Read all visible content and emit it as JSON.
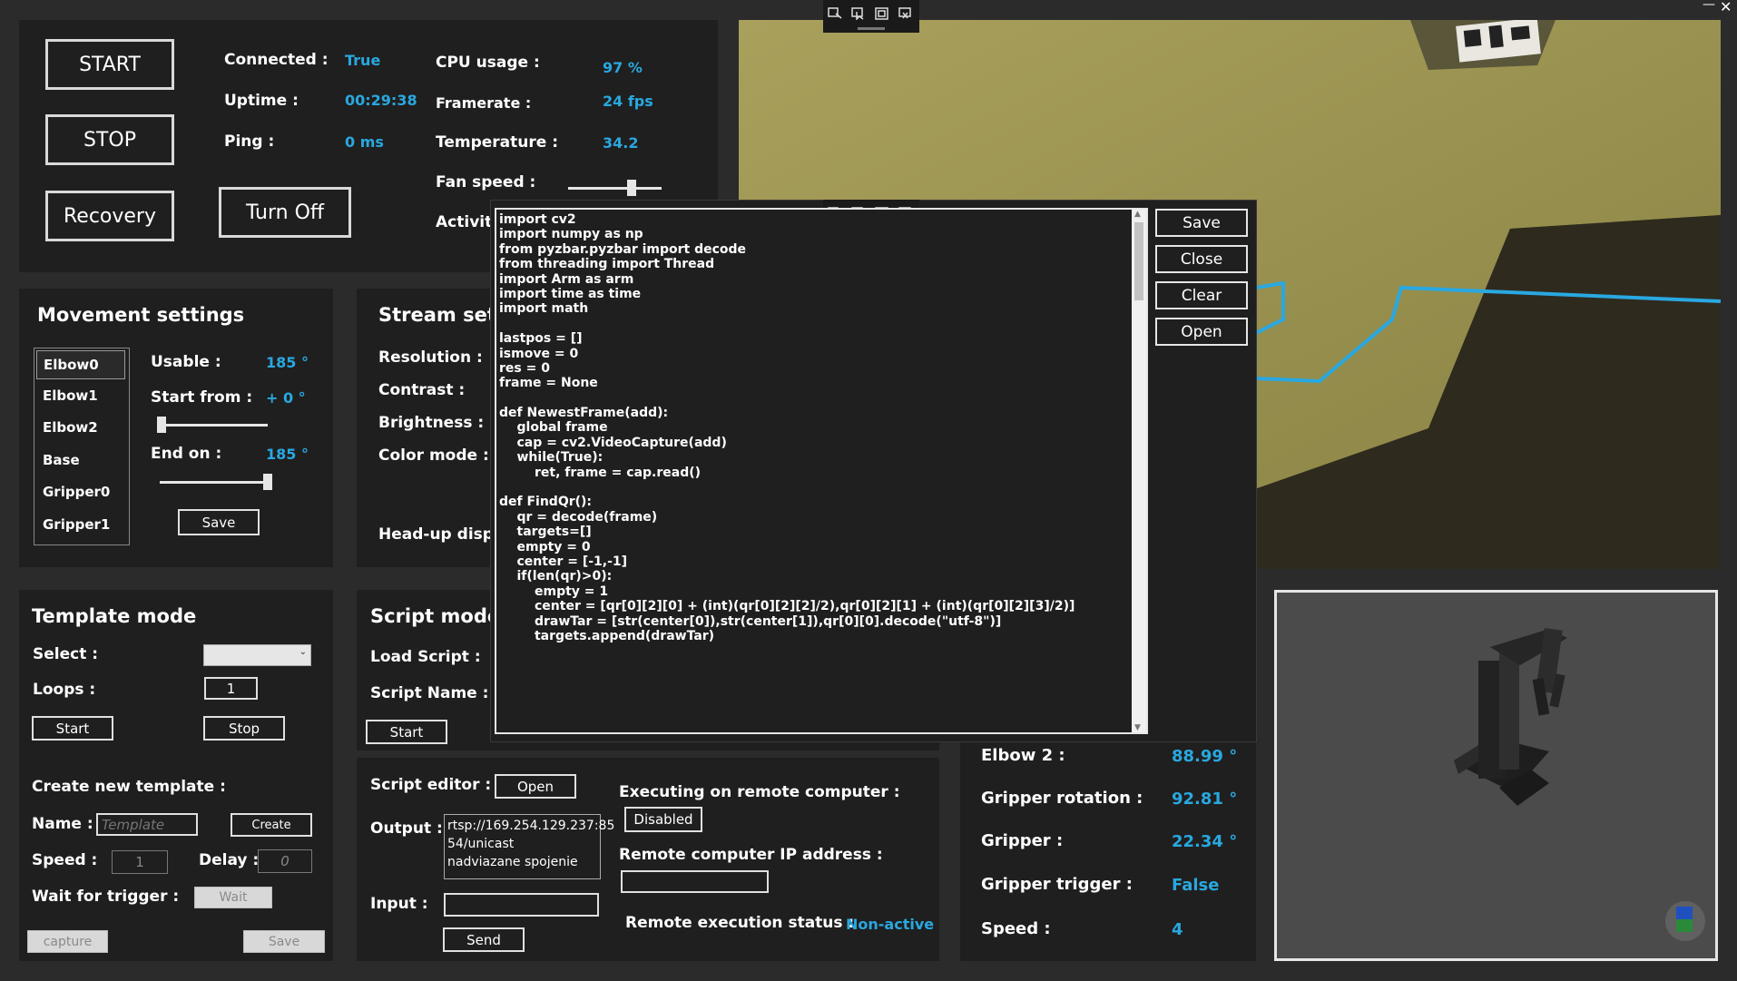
{
  "window": {
    "minimize_glyph": "—",
    "close_glyph": "✕"
  },
  "controls": {
    "start": "START",
    "stop": "STOP",
    "recovery": "Recovery",
    "turn_off": "Turn Off"
  },
  "status": {
    "connected_label": "Connected :",
    "connected_value": "True",
    "uptime_label": "Uptime :",
    "uptime_value": "00:29:38",
    "ping_label": "Ping :",
    "ping_value": "0 ms",
    "cpu_label": "CPU usage :",
    "cpu_value": "97 %",
    "framerate_label": "Framerate :",
    "framerate_value": "24 fps",
    "temperature_label": "Temperature :",
    "temperature_value": "34.2",
    "fan_label": "Fan speed :",
    "fan_level": 0.7,
    "activity_label": "Activit"
  },
  "movement": {
    "title": "Movement settings",
    "joints": [
      "Elbow0",
      "Elbow1",
      "Elbow2",
      "Base",
      "Gripper0",
      "Gripper1"
    ],
    "selected_joint": "Elbow0",
    "usable_label": "Usable :",
    "usable_value": "185 °",
    "start_label": "Start from :",
    "start_value": "+ 0 °",
    "start_level": 0.0,
    "end_label": "End on :",
    "end_value": "185 °",
    "end_level": 1.0,
    "save": "Save"
  },
  "stream": {
    "title": "Stream sett",
    "resolution_label": "Resolution :",
    "contrast_label": "Contrast :",
    "brightness_label": "Brightness :",
    "color_label": "Color mode :",
    "hud_label": "Head-up displ"
  },
  "template": {
    "title": "Template mode",
    "select_label": "Select :",
    "select_value": "",
    "loops_label": "Loops :",
    "loops_value": "1",
    "start": "Start",
    "stop": "Stop",
    "create_title": "Create new template :",
    "name_label": "Name :",
    "name_placeholder": "Template",
    "create": "Create",
    "speed_label": "Speed :",
    "speed_value": "1",
    "delay_label": "Delay :",
    "delay_value": "0",
    "trigger_label": "Wait for trigger :",
    "wait": "Wait",
    "capture": "capture",
    "save": "Save"
  },
  "script": {
    "title": "Script mode",
    "load_label": "Load Script :",
    "name_label": "Script Name :",
    "start": "Start",
    "editor_label": "Script editor :",
    "editor_open": "Open",
    "output_label": "Output :",
    "output_lines": [
      "rtsp://169.254.129.237:85",
      "54/unicast",
      "nadviazane spojenie"
    ],
    "input_label": "Input :",
    "input_value": "",
    "send": "Send"
  },
  "remote": {
    "exec_label": "Executing on remote computer :",
    "exec_button": "Disabled",
    "ip_label": "Remote computer IP address :",
    "ip_value": "",
    "status_label": "Remote execution status :",
    "status_value": "Non-active"
  },
  "joints_readout": {
    "elbow2_label": "Elbow 2 :",
    "elbow2_value": "88.99 °",
    "grip_rot_label": "Gripper rotation :",
    "grip_rot_value": "92.81 °",
    "gripper_label": "Gripper :",
    "gripper_value": "22.34 °",
    "trigger_label": "Gripper trigger :",
    "trigger_value": "False",
    "speed_label": "Speed :",
    "speed_value": "4"
  },
  "editor": {
    "save": "Save",
    "close": "Close",
    "clear": "Clear",
    "open": "Open",
    "code": [
      "import cv2",
      "import numpy as np",
      "from pyzbar.pyzbar import decode",
      "from threading import Thread",
      "import Arm as arm",
      "import time as time",
      "import math",
      "",
      "lastpos = []",
      "ismove = 0",
      "res = 0",
      "frame = None",
      "",
      "def NewestFrame(add):",
      "    global frame",
      "    cap = cv2.VideoCapture(add)",
      "    while(True):",
      "        ret, frame = cap.read()",
      "",
      "def FindQr():",
      "    qr = decode(frame)",
      "    targets=[]",
      "    empty = 0",
      "    center = [-1,-1]",
      "    if(len(qr)>0):",
      "        empty = 1",
      "        center = [qr[0][2][0] + (int)(qr[0][2][2]/2),qr[0][2][1] + (int)(qr[0][2][3]/2)]",
      "        drawTar = [str(center[0]),str(center[1]),qr[0][0].decode(\"utf-8\")]",
      "        targets.append(drawTar)"
    ]
  },
  "colors": {
    "accent": "#29a8e0",
    "panel": "#1f1f1f",
    "background": "#2b2b2b",
    "overlay_line": "#29a8e0"
  }
}
